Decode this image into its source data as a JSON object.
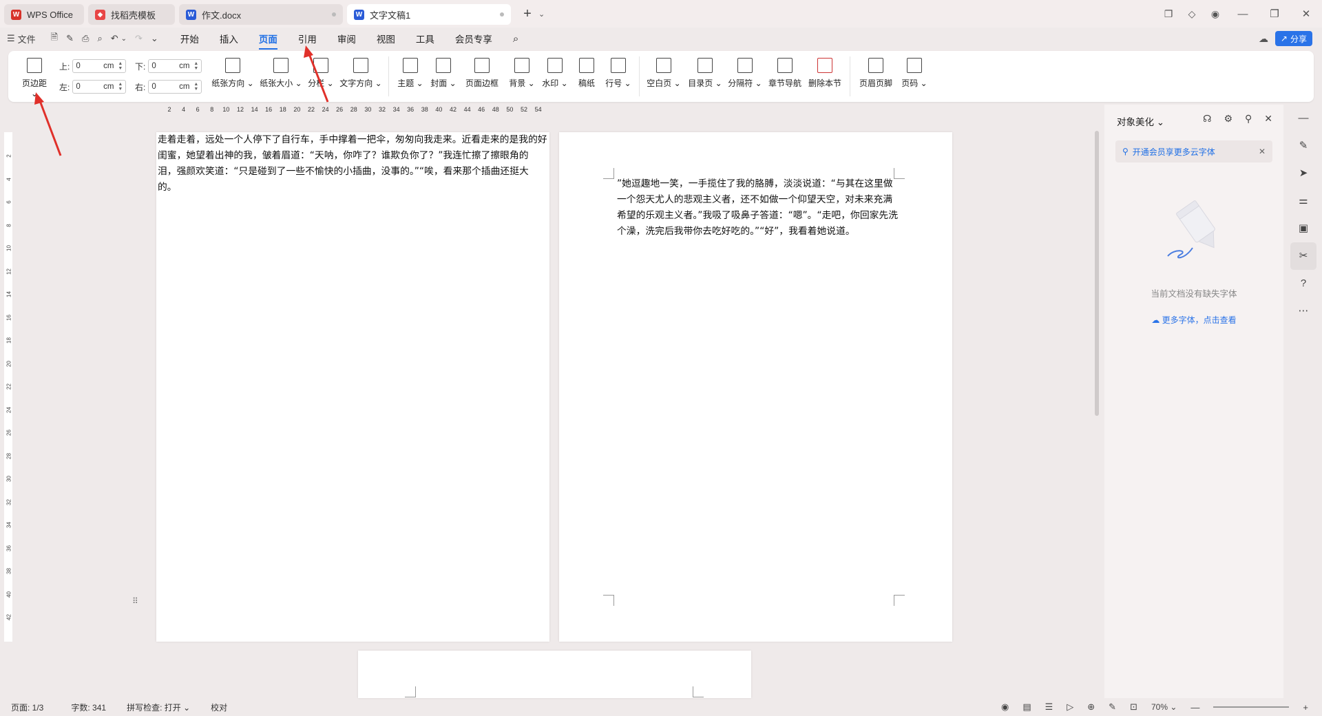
{
  "tabs": [
    {
      "label": "WPS Office",
      "icon": "wps-logo-icon",
      "color": "#d7322a"
    },
    {
      "label": "找稻壳模板",
      "icon": "docer-icon",
      "color": "#e84545"
    },
    {
      "label": "作文.docx",
      "icon": "word-doc-icon",
      "color": "#2a5bd7"
    },
    {
      "label": "文字文稿1",
      "icon": "word-doc-icon",
      "color": "#2a5bd7"
    }
  ],
  "menubar": {
    "file": "文件",
    "items": [
      "开始",
      "插入",
      "页面",
      "引用",
      "审阅",
      "视图",
      "工具",
      "会员专享"
    ],
    "active": "页面",
    "share": "分享"
  },
  "ribbon": {
    "margin_btn": "页边距",
    "margins": {
      "top_label": "上:",
      "top_value": "0",
      "bottom_label": "下:",
      "bottom_value": "0",
      "left_label": "左:",
      "left_value": "0",
      "right_label": "右:",
      "right_value": "0",
      "unit": "cm"
    },
    "groups": [
      "纸张方向",
      "纸张大小",
      "分栏",
      "文字方向",
      "主题",
      "封面",
      "页面边框",
      "背景",
      "水印",
      "稿纸",
      "行号",
      "空白页",
      "目录页",
      "分隔符",
      "章节导航",
      "删除本节",
      "页眉页脚",
      "页码"
    ]
  },
  "ruler": {
    "ticks": [
      "2",
      "4",
      "6",
      "8",
      "10",
      "12",
      "14",
      "16",
      "18",
      "20",
      "22",
      "24",
      "26",
      "28",
      "30",
      "32",
      "34",
      "36",
      "38",
      "40",
      "42",
      "44",
      "46",
      "48",
      "50",
      "52",
      "54"
    ],
    "vticks": [
      "2",
      "4",
      "6",
      "8",
      "10",
      "12",
      "14",
      "16",
      "18",
      "20",
      "22",
      "24",
      "26",
      "28",
      "30",
      "32",
      "34",
      "36",
      "38",
      "40",
      "42"
    ]
  },
  "document": {
    "page1_text": "走着走着，远处一个人停下了自行车，手中撑着一把伞，匆匆向我走来。近看走来的是我的好闺蜜，她望着出神的我，皱着眉道：“天呐，你咋了？谁欺负你了？”我连忙擦了擦眼角的泪，强颜欢笑道：“只是碰到了一些不愉快的小插曲，没事的。”“唉，看来那个插曲还挺大的。",
    "page2_text": "”她逗趣地一笑，一手揽住了我的胳膊，淡淡说道：“与其在这里做一个怨天尤人的悲观主义者，还不如做一个仰望天空，对未来充满希望的乐观主义者。”我吸了吸鼻子答道：“嗯”。“走吧，你回家先洗个澡，洗完后我带你去吃好吃的。”“好”，我看着她说道。"
  },
  "right_panel": {
    "title": "对象美化",
    "notice": "开通会员享更多云字体",
    "empty_text": "当前文档没有缺失字体",
    "link": "更多字体，点击查看"
  },
  "statusbar": {
    "page": "页面: 1/3",
    "words": "字数: 341",
    "spell": "拼写检查: 打开",
    "proof": "校对",
    "zoom": "70%"
  },
  "colors": {
    "accent": "#1f6fe5",
    "annotation_arrow": "#e0302a"
  }
}
